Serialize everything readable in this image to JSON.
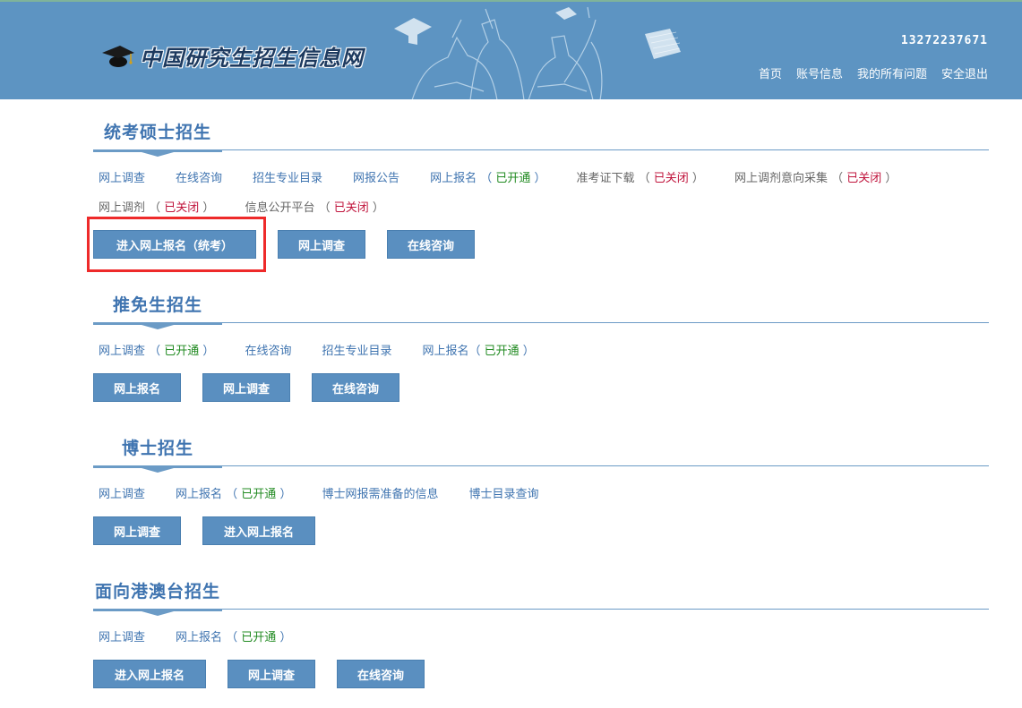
{
  "header": {
    "site_title": "中国研究生招生信息网",
    "username": "13272237671",
    "nav": [
      {
        "label": "首页"
      },
      {
        "label": "账号信息"
      },
      {
        "label": "我的所有问题"
      },
      {
        "label": "安全退出"
      }
    ],
    "bg_color": "#5d94c2"
  },
  "sections": [
    {
      "title": "统考硕士招生",
      "links": [
        {
          "label": "网上调查"
        },
        {
          "label": "在线咨询"
        },
        {
          "label": "招生专业目录"
        },
        {
          "label": "网报公告"
        },
        {
          "label": "网上报名",
          "status": "已开通"
        },
        {
          "label": "准考证下载",
          "status": "已关闭"
        },
        {
          "label": "网上调剂意向采集",
          "status": "已关闭"
        },
        {
          "label": "网上调剂",
          "status": "已关闭"
        },
        {
          "label": "信息公开平台",
          "status": "已关闭"
        }
      ],
      "buttons": [
        {
          "label": "进入网上报名（统考）"
        },
        {
          "label": "网上调查"
        },
        {
          "label": "在线咨询"
        }
      ]
    },
    {
      "title": "推免生招生",
      "links": [
        {
          "label": "网上调查",
          "status": "已开通"
        },
        {
          "label": "在线咨询"
        },
        {
          "label": "招生专业目录"
        },
        {
          "label": "网上报名",
          "status": "已开通"
        }
      ],
      "buttons": [
        {
          "label": "网上报名"
        },
        {
          "label": "网上调查"
        },
        {
          "label": "在线咨询"
        }
      ]
    },
    {
      "title": "博士招生",
      "links": [
        {
          "label": "网上调查"
        },
        {
          "label": "网上报名",
          "status": "已开通"
        },
        {
          "label": "博士网报需准备的信息"
        },
        {
          "label": "博士目录查询"
        }
      ],
      "buttons": [
        {
          "label": "网上调查"
        },
        {
          "label": "进入网上报名"
        }
      ]
    },
    {
      "title": "面向港澳台招生",
      "links": [
        {
          "label": "网上调查"
        },
        {
          "label": "网上报名",
          "status": "已开通"
        }
      ],
      "buttons": [
        {
          "label": "进入网上报名"
        },
        {
          "label": "网上调查"
        },
        {
          "label": "在线咨询"
        }
      ]
    }
  ],
  "colors": {
    "accent": "#3f74b0",
    "button": "#5a8fc0",
    "status_open": "#228b22",
    "status_closed": "#c0143c",
    "highlight": "#ee2a2a"
  }
}
